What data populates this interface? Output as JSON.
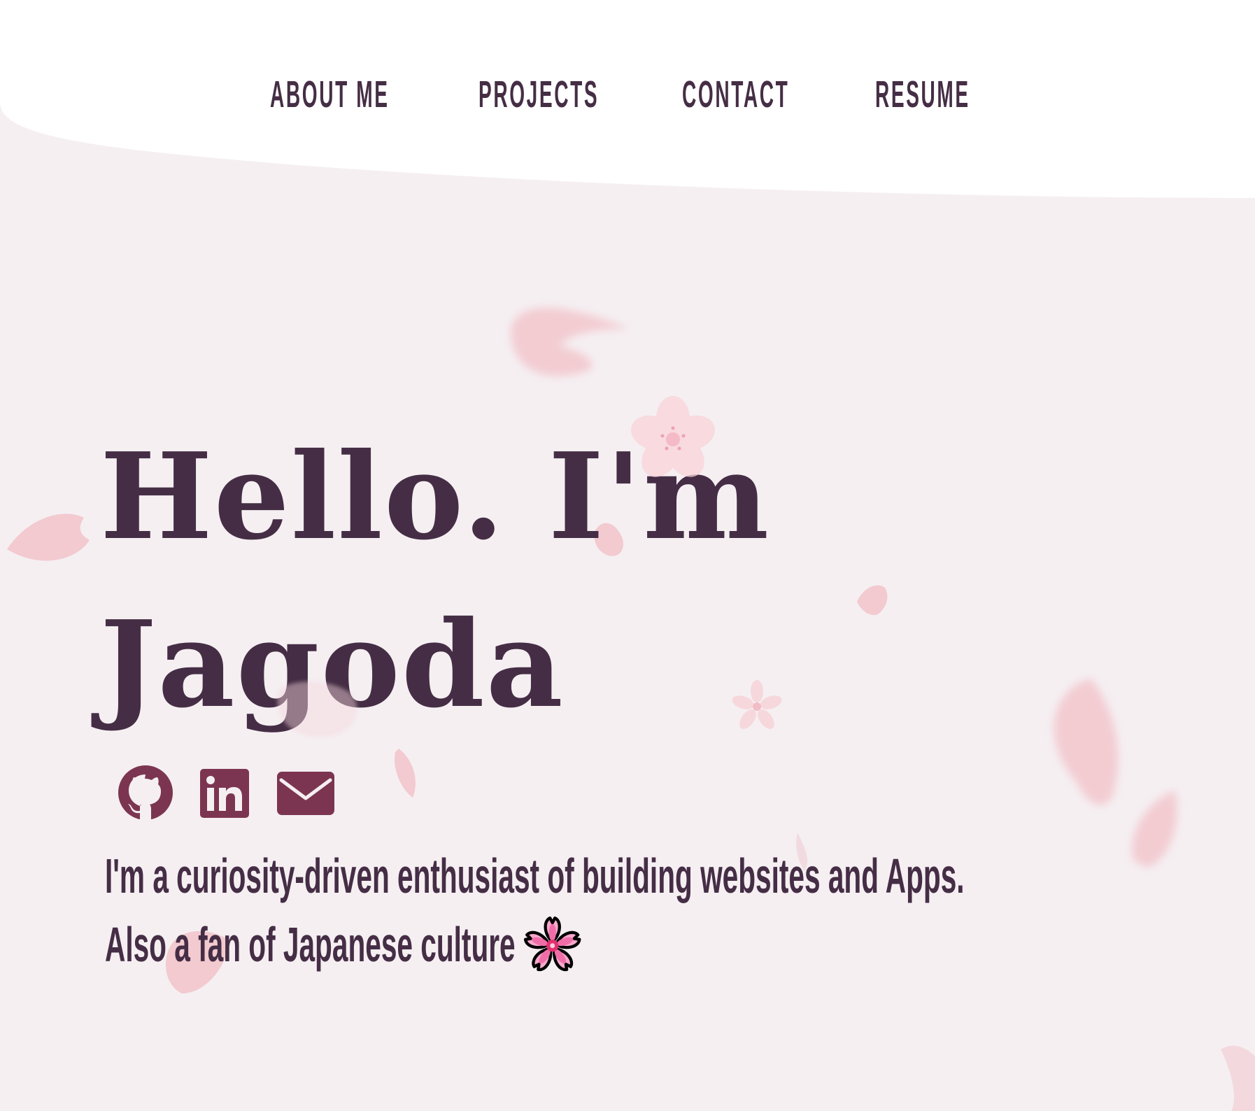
{
  "nav": {
    "items": [
      {
        "label": "ABOUT ME"
      },
      {
        "label": "PROJECTS"
      },
      {
        "label": "CONTACT"
      },
      {
        "label": "RESUME"
      }
    ]
  },
  "hero": {
    "line1": "Hello. I'm",
    "line2": "Jagoda"
  },
  "social": [
    {
      "icon": "github-icon"
    },
    {
      "icon": "linkedin-icon"
    },
    {
      "icon": "email-icon"
    }
  ],
  "intro": {
    "line1": "I'm a curiosity-driven enthusiast of building websites and Apps.",
    "line2": "Also a fan of Japanese culture",
    "line2_icon": "cherry-blossom-icon"
  },
  "colors": {
    "background": "#f5eff2",
    "header": "#ffffff",
    "text": "#452e45",
    "icon": "#7c3550",
    "petal": "#f2c9cf",
    "blossom": "#f06ea8"
  }
}
